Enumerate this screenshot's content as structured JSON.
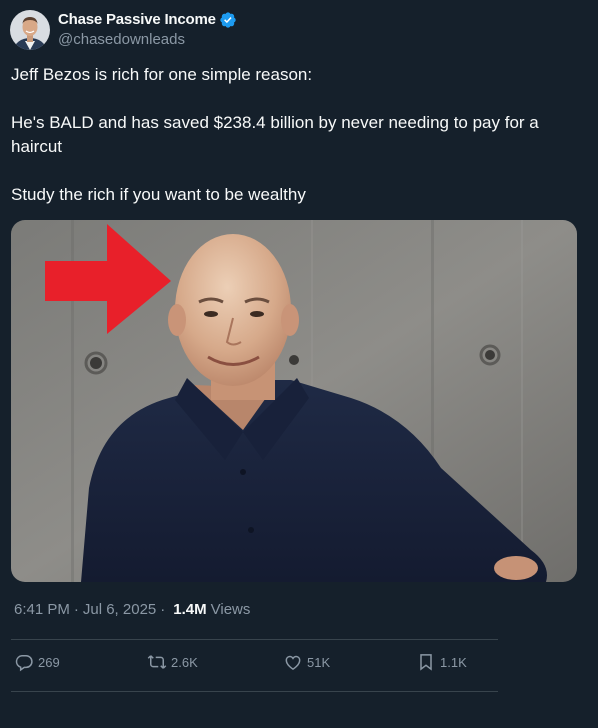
{
  "author": {
    "display_name": "Chase Passive Income",
    "handle": "@chasedownleads",
    "verified": true,
    "avatar_icon": "profile-photo"
  },
  "tweet": {
    "lines": [
      "Jeff Bezos is rich for one simple reason:",
      "He's BALD and has saved $238.4 billion by never needing to pay for a haircut",
      "Study the rich if you want to be wealthy"
    ],
    "media_icon": "photo-bald-man-with-red-arrow"
  },
  "meta": {
    "time": "6:41 PM",
    "separator": "·",
    "date": "Jul 6, 2025",
    "views_count": "1.4M",
    "views_label": "Views"
  },
  "actions": {
    "replies": "269",
    "reposts": "2.6K",
    "likes": "51K",
    "bookmarks": "1.1K"
  },
  "colors": {
    "background": "#15202b",
    "text_primary": "#f7f9f9",
    "text_secondary": "#8b98a5",
    "verified_blue": "#1d9bf0",
    "arrow_red": "#e8202a"
  }
}
